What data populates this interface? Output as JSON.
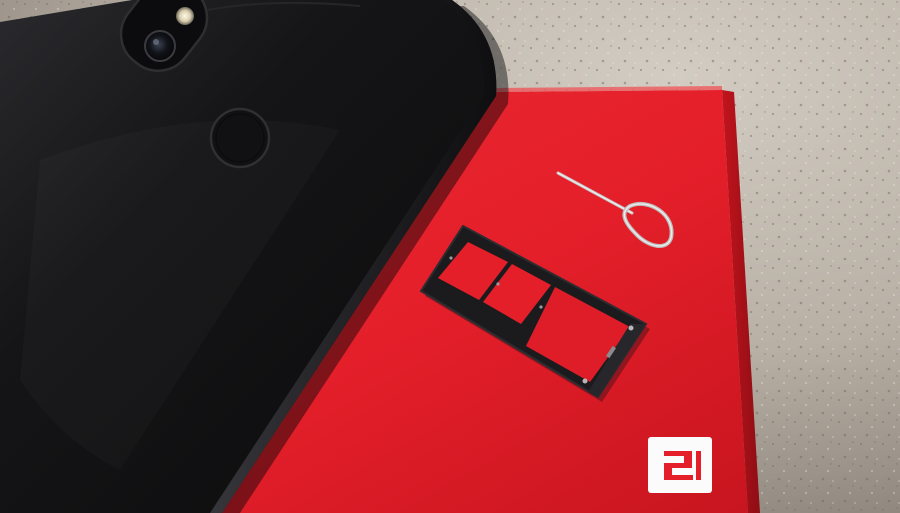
{
  "scene": {
    "background_surface": "granite-countertop",
    "objects": [
      {
        "name": "smartphone",
        "color": "#121214",
        "orientation": "rear-facing"
      },
      {
        "name": "product-box",
        "color": "#e41f2a"
      },
      {
        "name": "sim-card-tray",
        "slots": 3,
        "color": "#1b1b1e"
      },
      {
        "name": "sim-ejector-pin",
        "color": "#c9c9c9"
      }
    ],
    "icons": [
      {
        "name": "brand-logo-icon",
        "kind": "logo"
      },
      {
        "name": "fingerprint-sensor-icon",
        "kind": "hardware"
      },
      {
        "name": "camera-lens-icon",
        "kind": "hardware"
      },
      {
        "name": "flash-icon",
        "kind": "hardware"
      }
    ],
    "colors": {
      "box_red": "#e41f2a",
      "box_red_shadow": "#b3141d",
      "phone_black": "#121214",
      "countertop": "#b9b1a6"
    }
  }
}
